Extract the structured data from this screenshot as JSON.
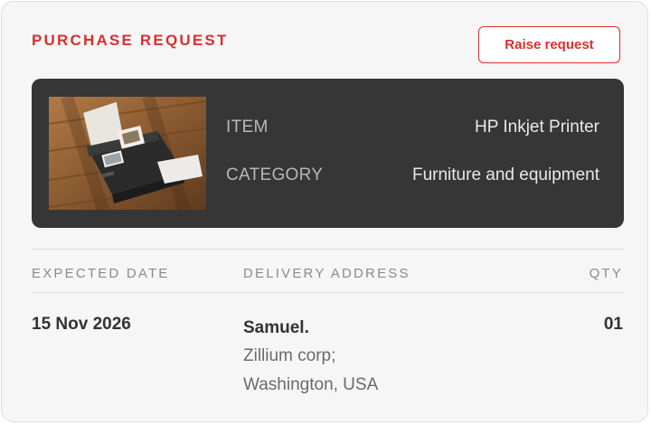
{
  "header": {
    "title": "PURCHASE REQUEST",
    "raise_label": "Raise request"
  },
  "item": {
    "image_icon": "printer-photo",
    "item_label": "ITEM",
    "item_value": "HP Inkjet Printer",
    "category_label": "CATEGORY",
    "category_value": "Furniture and equipment"
  },
  "details": {
    "columns": {
      "expected_date": "EXPECTED DATE",
      "delivery_address": "DELIVERY ADDRESS",
      "qty": "QTY"
    },
    "expected_date": "15 Nov 2026",
    "address": {
      "name": "Samuel.",
      "line1": "Zillium corp;",
      "line2": "Washington, USA"
    },
    "qty": "01"
  },
  "colors": {
    "accent": "#d7312f",
    "panel": "#363636",
    "card_bg": "#f6f6f6"
  }
}
